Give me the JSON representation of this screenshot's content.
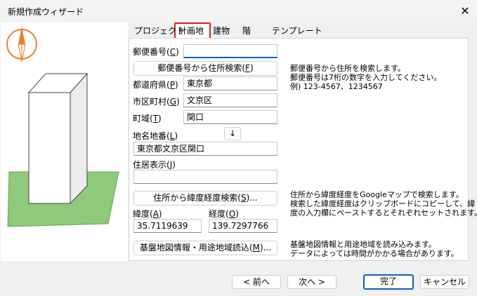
{
  "window": {
    "title": "新規作成ウィザード",
    "close_glyph": "✕"
  },
  "tabs": [
    {
      "label": "プロジェクト",
      "active": false
    },
    {
      "label": "計画地",
      "active": true
    },
    {
      "label": "建物",
      "active": false
    },
    {
      "label": "階",
      "active": false
    },
    {
      "label": "テンプレート",
      "active": false
    }
  ],
  "form": {
    "postal_label": "郵便番号(",
    "postal_key": "C",
    "postal_value": "",
    "search_address_button": {
      "label": "郵便番号から住所検索(",
      "key": "F"
    },
    "postal_help": "郵便番号から住所を検索します。\n郵便番号は7桁の数字を入力してください。\n例) 123-4567、1234567",
    "prefecture_label": "都道府県(",
    "prefecture_key": "P",
    "prefecture_value": "東京都",
    "city_label": "市区町村(",
    "city_key": "G",
    "city_value": "文京区",
    "town_label": "町域(",
    "town_key": "T",
    "town_value": "関口",
    "lot_label": "地名地番(",
    "lot_key": "L",
    "copy_down_glyph": "↓",
    "lot_value": "東京都文京区関口",
    "residence_label": "住居表示(",
    "residence_key": "J",
    "residence_value": "",
    "latlng_button": {
      "label": "住所から緯度経度検索(",
      "key": "S",
      "suffix": ")..."
    },
    "latlng_help": "住所から緯度経度をGoogleマップで検索します。\n検索した緯度経度はクリップボードにコピーして、緯\n度の入力欄にペーストするとそれぞれセットされます。",
    "lat_label": "緯度(",
    "lat_key": "A",
    "lat_value": "35.7119639",
    "lng_label": "経度(",
    "lng_key": "O",
    "lng_value": "139.7297766",
    "base_map_button": {
      "label": "基盤地図情報・用途地域読込(",
      "key": "M",
      "suffix": ")..."
    },
    "base_map_help": "基盤地図情報と用途地域を読み込みます。\nデータによっては時間がかかる場合があります。"
  },
  "footer": {
    "back_label": "< 前へ",
    "next_label": "次へ >",
    "finish_label": "完了",
    "cancel_label": "キャンセル"
  },
  "colors": {
    "active_tab_outline": "#e0201f",
    "compass_ring": "#f07b2c",
    "ground": "#8fc97a",
    "focus_blue": "#0a5fc4"
  }
}
